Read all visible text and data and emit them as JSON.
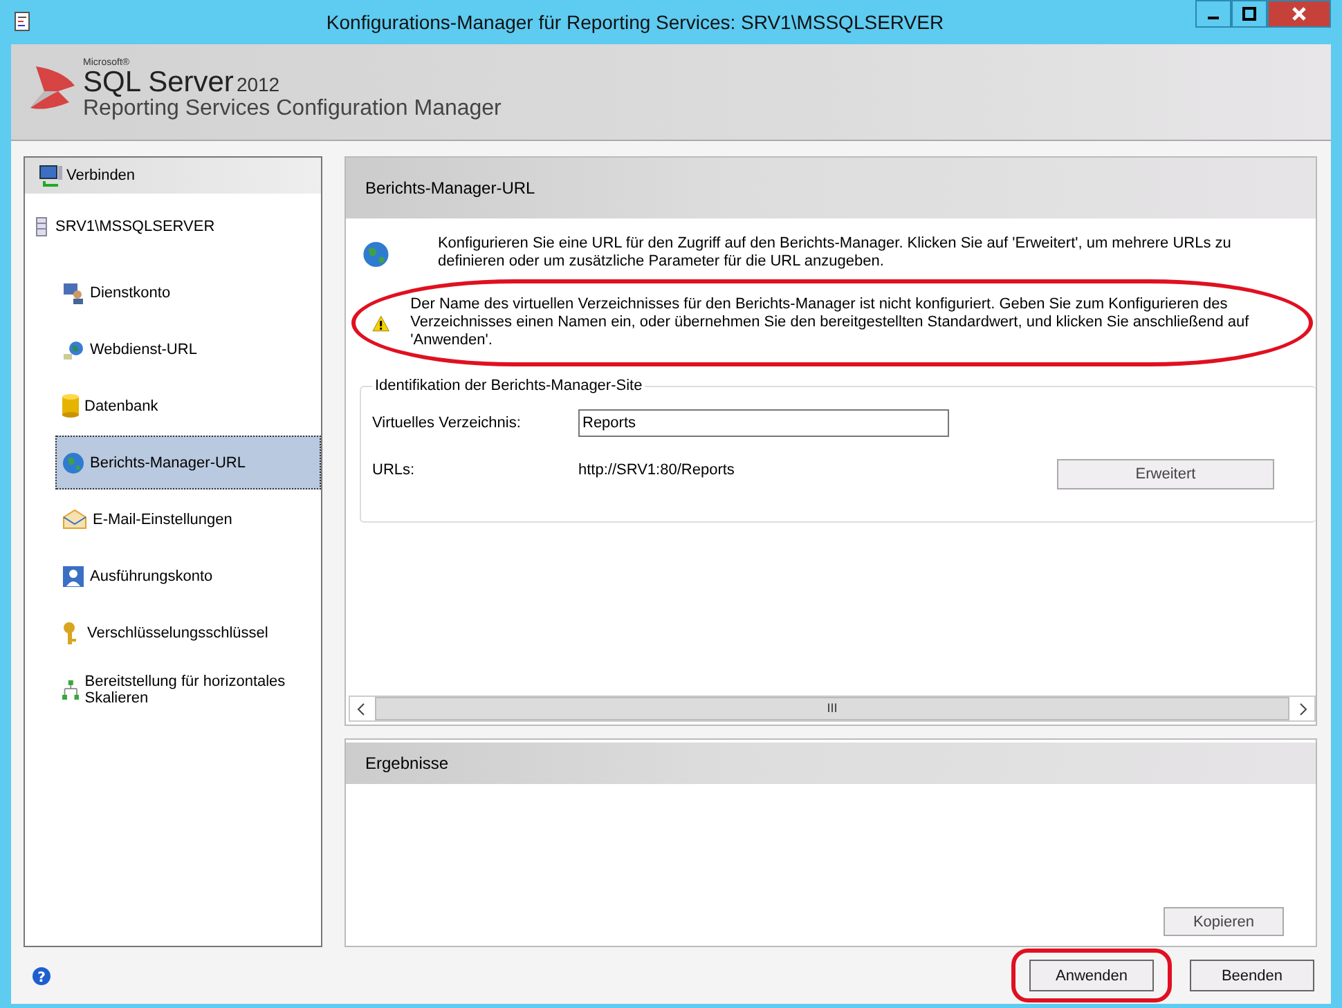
{
  "window": {
    "title": "Konfigurations-Manager für Reporting Services: SRV1\\MSSQLSERVER"
  },
  "header": {
    "brand_small": "Microsoft®",
    "brand": "SQL Server",
    "version": "2012",
    "product": "Reporting Services Configuration Manager"
  },
  "sidebar": {
    "connect": "Verbinden",
    "server": "SRV1\\MSSQLSERVER",
    "items": [
      {
        "label": "Dienstkonto",
        "kind": "service",
        "selected": false
      },
      {
        "label": "Webdienst-URL",
        "kind": "web",
        "selected": false
      },
      {
        "label": "Datenbank",
        "kind": "database",
        "selected": false
      },
      {
        "label": "Berichts-Manager-URL",
        "kind": "globe",
        "selected": true
      },
      {
        "label": "E-Mail-Einstellungen",
        "kind": "mail",
        "selected": false
      },
      {
        "label": "Ausführungskonto",
        "kind": "user",
        "selected": false
      },
      {
        "label": "Verschlüsselungsschlüssel",
        "kind": "keys",
        "selected": false
      },
      {
        "label": "Bereitstellung für horizontales Skalieren",
        "kind": "scaleout",
        "selected": false
      }
    ]
  },
  "panel": {
    "title": "Berichts-Manager-URL",
    "intro": "Konfigurieren Sie eine URL für den Zugriff auf den Berichts-Manager. Klicken Sie auf 'Erweitert', um mehrere URLs zu definieren oder um zusätzliche Parameter für die URL anzugeben.",
    "warning": "Der Name des virtuellen Verzeichnisses für den Berichts-Manager ist nicht konfiguriert. Geben Sie zum Konfigurieren des Verzeichnisses einen Namen ein, oder übernehmen Sie den bereitgestellten Standardwert, und klicken Sie anschließend auf 'Anwenden'.",
    "group_title": "Identifikation der Berichts-Manager-Site",
    "vdir_label": "Virtuelles Verzeichnis:",
    "vdir_value": "Reports",
    "urls_label": "URLs:",
    "urls_value": "http://SRV1:80/Reports",
    "advanced_button": "Erweitert",
    "scroll_grip": "III"
  },
  "results": {
    "title": "Ergebnisse",
    "copy_button": "Kopieren"
  },
  "help": {
    "glyph": "?"
  },
  "buttons": [
    {
      "label": "Anwenden",
      "highlighted": true
    },
    {
      "label": "Beenden",
      "highlighted": false
    }
  ]
}
